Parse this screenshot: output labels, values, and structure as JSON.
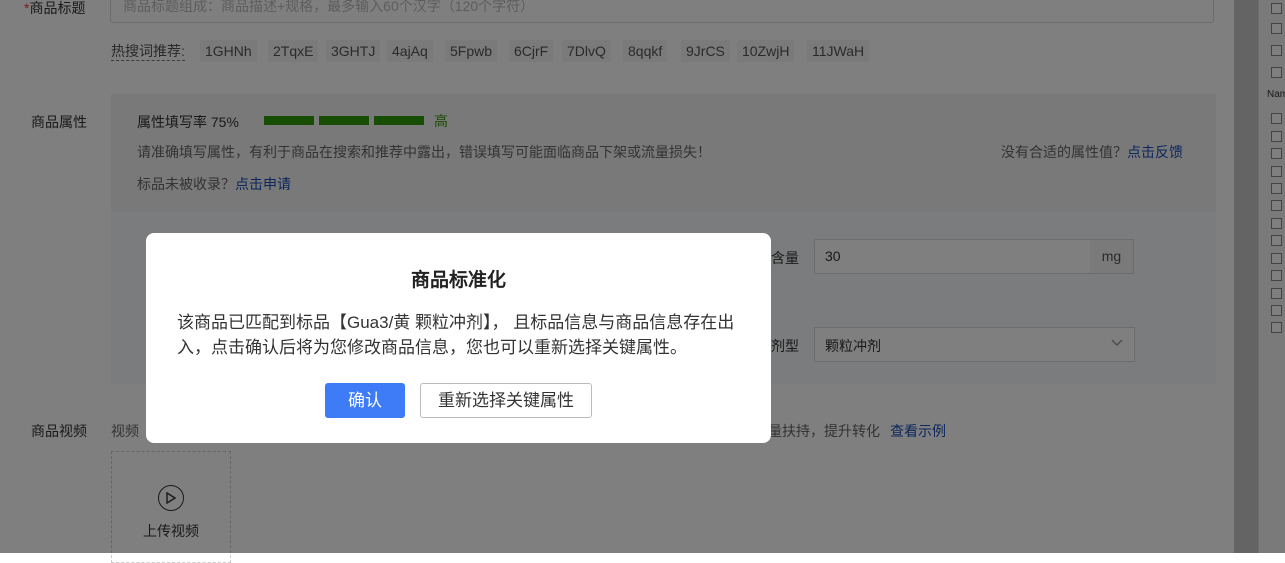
{
  "form": {
    "title_label": "商品标题",
    "required_mark": "*",
    "title_placeholder": "商品标题组成：商品描述+规格，最多输入60个汉字（120个字符）",
    "hot_label": "热搜词推荐:",
    "hot_words": [
      "1GHNh",
      "2TqxE",
      "3GHTJ",
      "4ajAq",
      "5Fpwb",
      "6CjrF",
      "7DlvQ",
      "8qqkf",
      "9JrCS",
      "10ZwjH",
      "11JWaH"
    ],
    "attr_label": "商品属性",
    "attr_rate": "属性填写率 75%",
    "attr_level": "高",
    "attr_tip": "请准确填写属性，有利于商品在搜索和推荐中露出，错误填写可能面临商品下架或流量损失！",
    "attr_right_text": "没有合适的属性值？",
    "attr_right_link": "点击反馈",
    "unlisted_text": "标品未被收录？",
    "unlisted_link": "点击申请",
    "content_label": "含量",
    "content_value": "30",
    "content_unit": "mg",
    "form_label": "剂型",
    "form_value": "颗粒冲剂",
    "video_label": "商品视频",
    "video_hint_left": "视频",
    "video_hint_right": "量扶持，提升转化",
    "video_example_link": "查看示例",
    "upload_text": "上传视频"
  },
  "right_panel": {
    "name_col": "Nam"
  },
  "modal": {
    "title": "商品标准化",
    "body": "该商品已匹配到标品【Gua3/黄 颗粒冲剂】， 且标品信息与商品信息存在出入，点击确认后将为您修改商品信息，您也可以重新选择关键属性。",
    "confirm": "确认",
    "reselect": "重新选择关键属性"
  },
  "colors": {
    "primary": "#3d7bf7",
    "progress": "#2f9a00",
    "link": "#1a4fb8"
  }
}
